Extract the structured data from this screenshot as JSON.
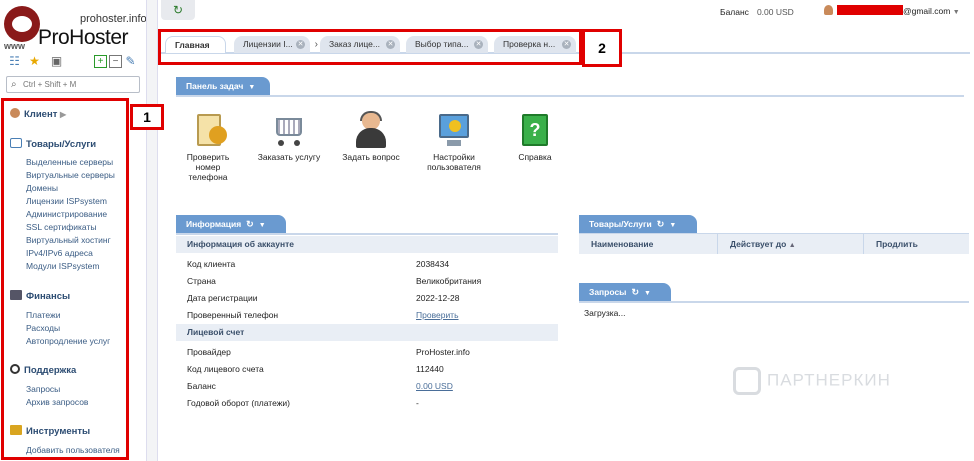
{
  "logo": {
    "site": "prohoster.info",
    "name": "ProHoster",
    "www": "www"
  },
  "search": {
    "placeholder": "Ctrl + Shift + M"
  },
  "nav": {
    "client": "Клиент",
    "goods": {
      "title": "Товары/Услуги",
      "items": [
        "Выделенные серверы",
        "Виртуальные серверы",
        "Домены",
        "Лицензии ISPsystem",
        "Администрирование",
        "SSL сертификаты",
        "Виртуальный хостинг",
        "IPv4/IPv6 адреса",
        "Модули ISPsystem"
      ]
    },
    "finance": {
      "title": "Финансы",
      "items": [
        "Платежи",
        "Расходы",
        "Автопродление услуг"
      ]
    },
    "support": {
      "title": "Поддержка",
      "items": [
        "Запросы",
        "Архив запросов"
      ]
    },
    "tools": {
      "title": "Инструменты",
      "items": [
        "Добавить пользователя"
      ]
    }
  },
  "header": {
    "balance_label": "Баланс",
    "balance_value": "0.00 USD",
    "email_suffix": "@gmail.com"
  },
  "tabs": [
    {
      "label": "Главная"
    },
    {
      "label": "Лицензии I..."
    },
    {
      "label": "Заказ лице..."
    },
    {
      "label": "Выбор типа..."
    },
    {
      "label": "Проверка н..."
    }
  ],
  "annotations": {
    "box1": "1",
    "box2": "2"
  },
  "taskbar": {
    "title": "Панель задач",
    "items": [
      "Проверить номер телефона",
      "Заказать услугу",
      "Задать вопрос",
      "Настройки пользователя",
      "Справка"
    ]
  },
  "info": {
    "title": "Информация",
    "account_section": "Информация об аккаунте",
    "rows": [
      {
        "label": "Код клиента",
        "value": "2038434"
      },
      {
        "label": "Страна",
        "value": "Великобритания"
      },
      {
        "label": "Дата регистрации",
        "value": "2022-12-28"
      },
      {
        "label": "Проверенный телефон",
        "value": "Проверить"
      }
    ],
    "account_section2": "Лицевой счет",
    "rows2": [
      {
        "label": "Провайдер",
        "value": "ProHoster.info"
      },
      {
        "label": "Код лицевого счета",
        "value": "112440"
      },
      {
        "label": "Баланс",
        "value": "0.00 USD"
      },
      {
        "label": "Годовой оборот (платежи)",
        "value": "-"
      }
    ]
  },
  "goods_panel": {
    "title": "Товары/Услуги",
    "columns": [
      "Наименование",
      "Действует до",
      "Продлить"
    ]
  },
  "requests_panel": {
    "title": "Запросы",
    "loading": "Загрузка..."
  },
  "watermark": "ПАРТНЕРКИН",
  "colors": {
    "accent": "#6a9ad0",
    "link": "#3a5c84",
    "annotation": "#e00000"
  }
}
